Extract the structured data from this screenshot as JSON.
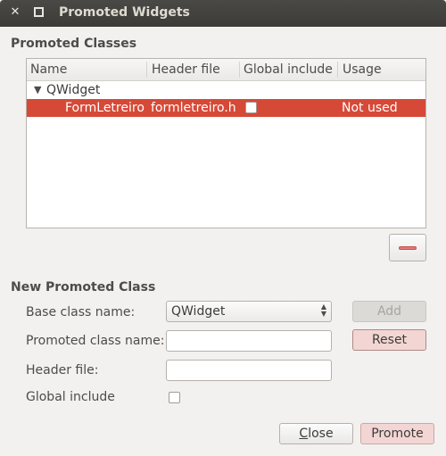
{
  "window": {
    "title": "Promoted Widgets",
    "close_glyph": "✕"
  },
  "promoted_classes": {
    "heading": "Promoted Classes",
    "columns": [
      "Name",
      "Header file",
      "Global include",
      "Usage"
    ],
    "parent": {
      "name": "QWidget",
      "expander": "▼"
    },
    "rows": [
      {
        "name": "FormLetreiro",
        "header_file": "formletreiro.h",
        "global_include": false,
        "usage": "Not used",
        "selected": true
      }
    ],
    "remove_button": {
      "icon": "minus-icon"
    }
  },
  "new_promoted_class": {
    "heading": "New Promoted Class",
    "base_class_label": "Base class name:",
    "base_class_value": "QWidget",
    "promoted_class_label": "Promoted class name:",
    "promoted_class_value": "",
    "header_file_label": "Header file:",
    "header_file_value": "",
    "global_include_label": "Global include",
    "global_include_checked": false,
    "add_label": "Add",
    "reset_label": "Reset"
  },
  "footer": {
    "close_mnemonic": "C",
    "close_rest": "lose",
    "promote_label": "Promote"
  },
  "colors": {
    "selection": "#d64937",
    "titlebar": "#3c3b37",
    "background": "#f2f1f0"
  }
}
